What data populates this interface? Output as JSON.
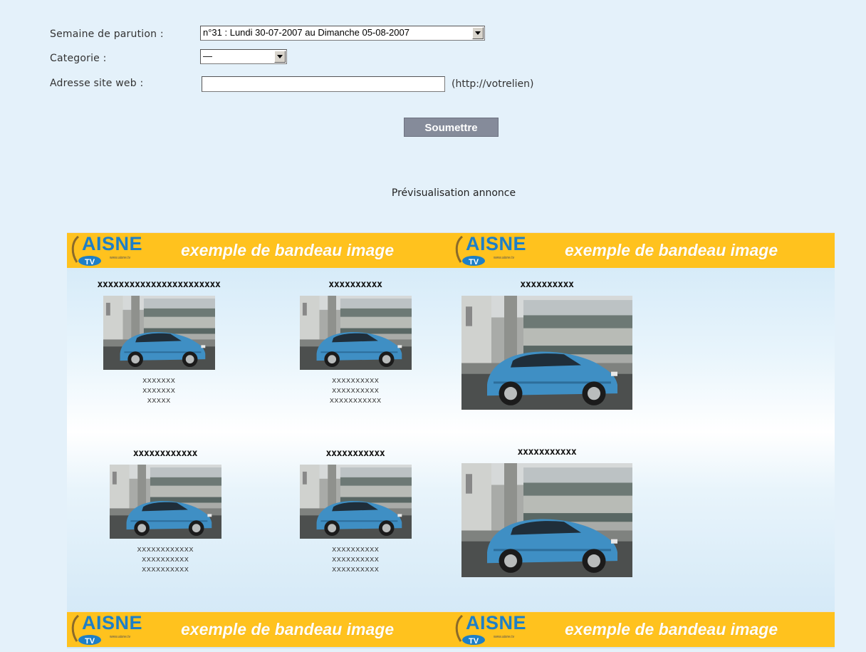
{
  "form": {
    "week_label": "Semaine de parution :",
    "week_value": "n°31 : Lundi 30-07-2007 au Dimanche 05-08-2007",
    "category_label": "Categorie :",
    "category_value": "—",
    "website_label": "Adresse site web :",
    "website_value": "",
    "website_hint": "(http://votrelien)",
    "submit_label": "Soumettre"
  },
  "preview": {
    "title": "Prévisualisation annonce",
    "banner": {
      "logo_text": "AISNE",
      "logo_sub": "TV",
      "logo_url": "www.aisne.tv",
      "slogan": "exemple de bandeau image"
    },
    "cards": [
      {
        "title": "xxxxxxxxxxxxxxxxxxxxxxx",
        "lines": [
          "xxxxxxx",
          "xxxxxxx",
          "xxxxx"
        ]
      },
      {
        "title": "xxxxxxxxxx",
        "lines": [
          "xxxxxxxxxx",
          "xxxxxxxxxx",
          "xxxxxxxxxxx"
        ]
      },
      {
        "title": "xxxxxxxxxx",
        "lines": []
      },
      {
        "title": "xxxxxxxxxxxx",
        "lines": [
          "xxxxxxxxxxxx",
          "xxxxxxxxxx",
          "xxxxxxxxxx"
        ]
      },
      {
        "title": "xxxxxxxxxxx",
        "lines": [
          "xxxxxxxxxx",
          "xxxxxxxxxx",
          "xxxxxxxxxx"
        ]
      },
      {
        "title": "xxxxxxxxxxx",
        "lines": []
      }
    ]
  },
  "colors": {
    "page_bg": "#e4f1fa",
    "banner_bg": "#ffc21e",
    "logo_blue": "#1d7fc7",
    "button_bg": "#858b9a",
    "car_blue": "#3f8fc4"
  },
  "icons": {
    "dropdown": "chevron-down-icon",
    "logo": "aisne-tv-logo",
    "photo": "car-photo"
  }
}
